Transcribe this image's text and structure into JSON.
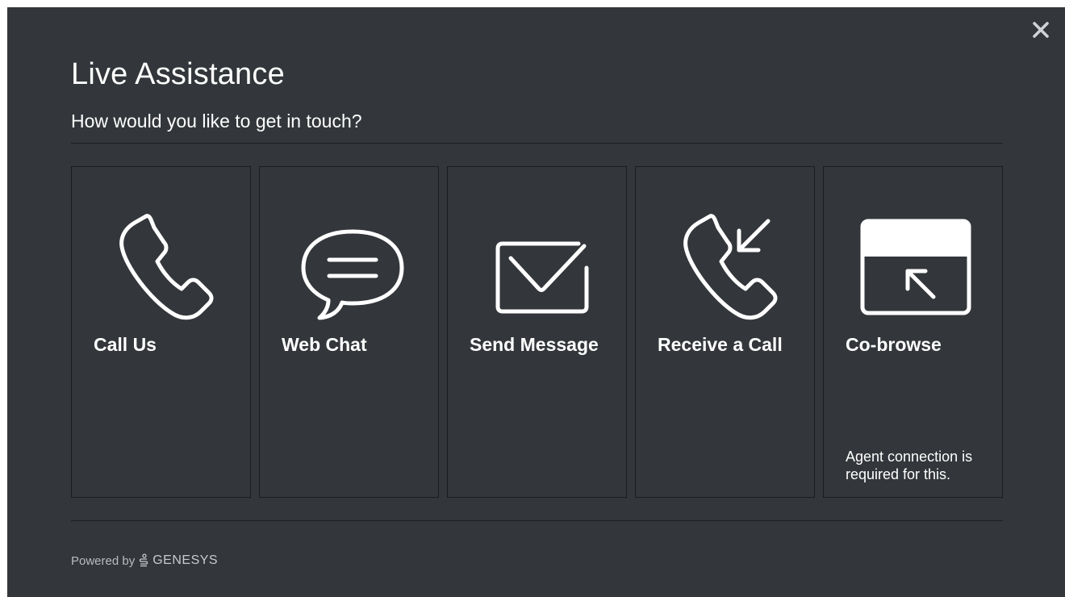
{
  "dialog": {
    "title": "Live Assistance",
    "subtitle": "How would you like to get in touch?",
    "close_icon": "close-icon"
  },
  "channels": [
    {
      "label": "Call Us",
      "icon": "phone-icon"
    },
    {
      "label": "Web Chat",
      "icon": "chat-bubble-icon"
    },
    {
      "label": "Send Message",
      "icon": "envelope-icon"
    },
    {
      "label": "Receive a Call",
      "icon": "phone-incoming-icon"
    },
    {
      "label": "Co-browse",
      "icon": "cobrowse-icon",
      "note": "Agent connection is required for this."
    }
  ],
  "footer": {
    "powered_by": "Powered by",
    "brand": "GENESYS",
    "brand_icon": "genesys-logo-icon"
  },
  "colors": {
    "background": "#33363a",
    "text": "#ffffff",
    "border": "#1a1c1e"
  }
}
